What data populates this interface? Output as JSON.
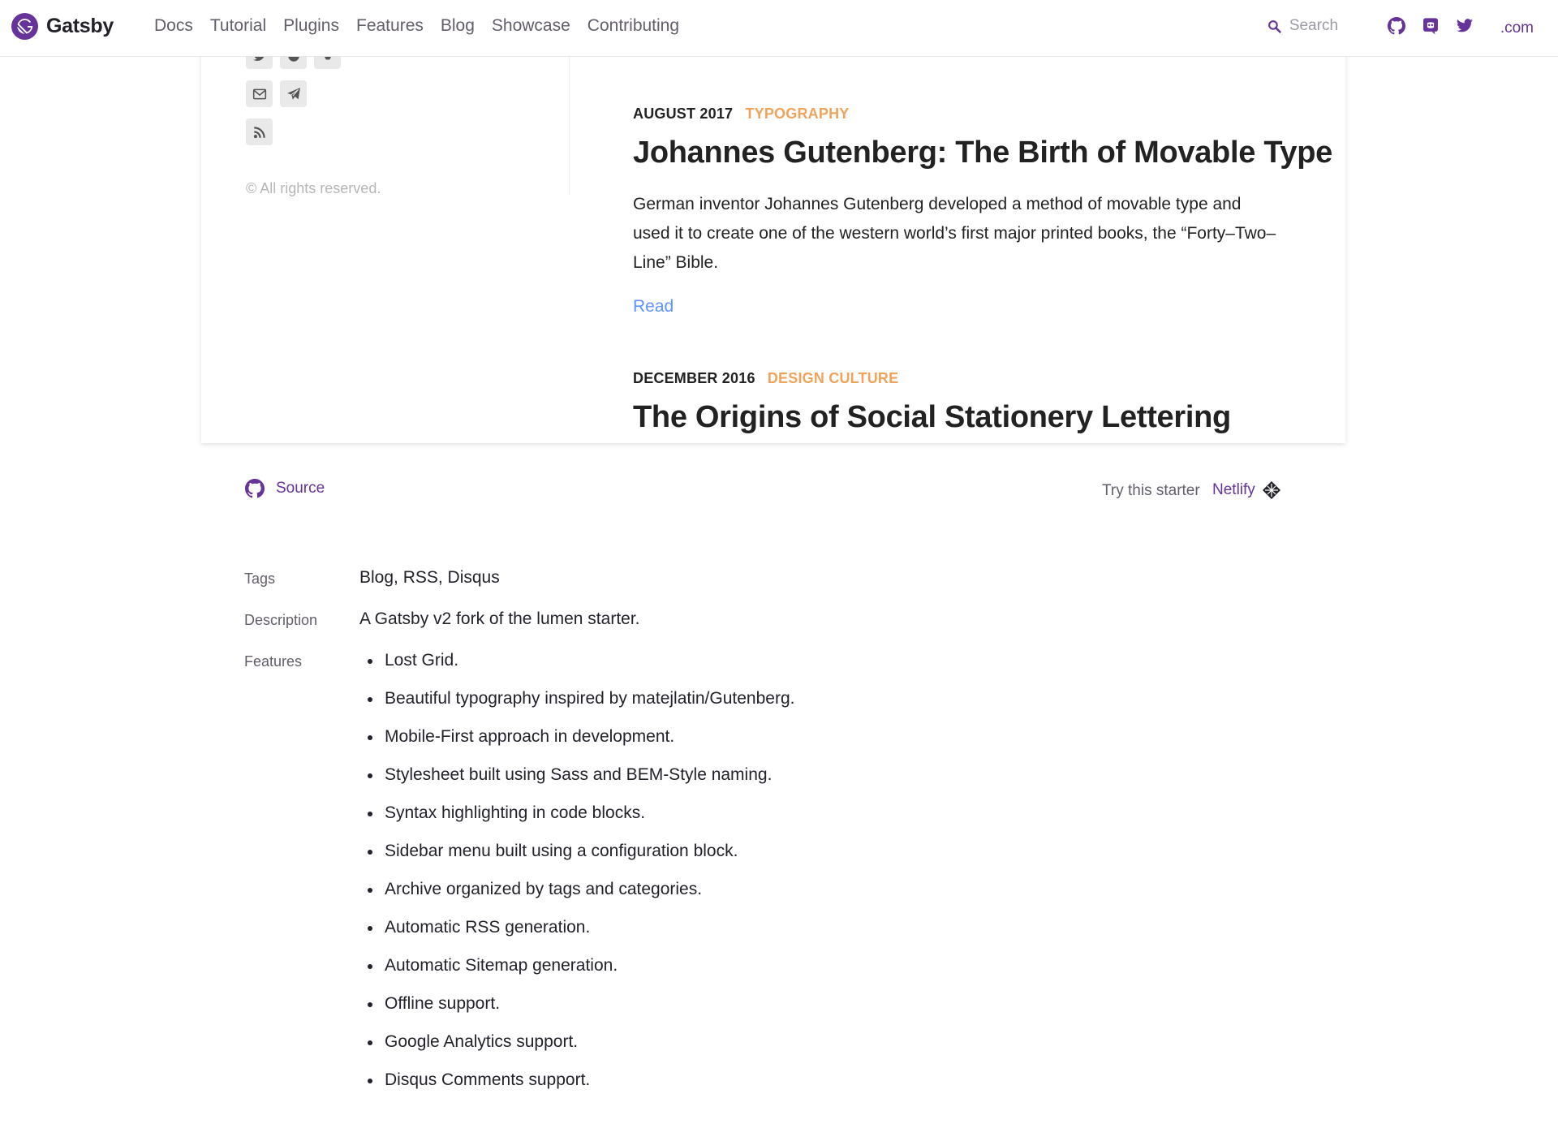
{
  "nav": {
    "brand": "Gatsby",
    "links": [
      "Docs",
      "Tutorial",
      "Plugins",
      "Features",
      "Blog",
      "Showcase",
      "Contributing"
    ],
    "search_placeholder": "Search",
    "icons": [
      "github-icon",
      "discord-icon",
      "twitter-icon"
    ],
    "dotcom": ".com"
  },
  "preview": {
    "copyright": "© All rights reserved.",
    "social_icons": [
      "twitter-icon",
      "github-icon",
      "vk-icon",
      "email-icon",
      "telegram-icon",
      "rss-icon"
    ],
    "posts": [
      {
        "date": "AUGUST 2017",
        "category": "TYPOGRAPHY",
        "title": "Johannes Gutenberg: The Birth of Movable Type",
        "description": "German inventor Johannes Gutenberg developed a method of movable type and used it to create one of the western world’s first major printed books, the “Forty–Two–Line” Bible.",
        "read_label": "Read"
      },
      {
        "date": "DECEMBER 2016",
        "category": "DESIGN CULTURE",
        "title": "The Origins of Social Stationery Lettering"
      }
    ],
    "colors": {
      "category": "#f0a35a",
      "read_link": "#5d93ff"
    }
  },
  "source_row": {
    "source_label": "Source",
    "try_label": "Try this starter",
    "netlify_label": "Netlify"
  },
  "details": {
    "tags_label": "Tags",
    "tags_value": "Blog, RSS, Disqus",
    "description_label": "Description",
    "description_value": "A Gatsby v2 fork of the lumen starter.",
    "features_label": "Features",
    "features": [
      "Lost Grid.",
      "Beautiful typography inspired by matejlatin/Gutenberg.",
      "Mobile-First approach in development.",
      "Stylesheet built using Sass and BEM-Style naming.",
      "Syntax highlighting in code blocks.",
      "Sidebar menu built using a configuration block.",
      "Archive organized by tags and categories.",
      "Automatic RSS generation.",
      "Automatic Sitemap generation.",
      "Offline support.",
      "Google Analytics support.",
      "Disqus Comments support."
    ]
  },
  "theme": {
    "brand_purple": "#663399",
    "text": "#232129",
    "muted": "#635e69"
  }
}
